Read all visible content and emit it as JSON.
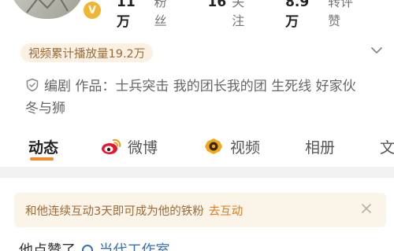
{
  "profile": {
    "verified_badge": "V",
    "stats": [
      {
        "num": "11万",
        "label": "粉丝"
      },
      {
        "num": "16",
        "label": "关注"
      },
      {
        "num": "8.9万",
        "label": "转评赞"
      }
    ]
  },
  "play_count": "视频累计播放量19.2万",
  "info": {
    "icon": "shield-icon",
    "text": "编剧 作品：士兵突击 我的团长我的团 生死线 好家伙 冬与狮"
  },
  "tabs": [
    {
      "label": "动态",
      "active": true
    },
    {
      "label": "微博",
      "icon": "weibo-icon"
    },
    {
      "label": "视频",
      "icon": "video-icon"
    },
    {
      "label": "相册"
    },
    {
      "label": "文"
    }
  ],
  "banner": {
    "message": "和他连续互动3天即可成为他的铁粉",
    "action": "去互动"
  },
  "bottom": {
    "prefix": "他点赞了",
    "link": "当代工作室"
  },
  "colors": {
    "accent": "#f28b2a",
    "banner_bg": "#fbf4e9",
    "pill_bg": "#fbf1e2",
    "badge": "#f2b531",
    "link": "#3a6fb5"
  }
}
